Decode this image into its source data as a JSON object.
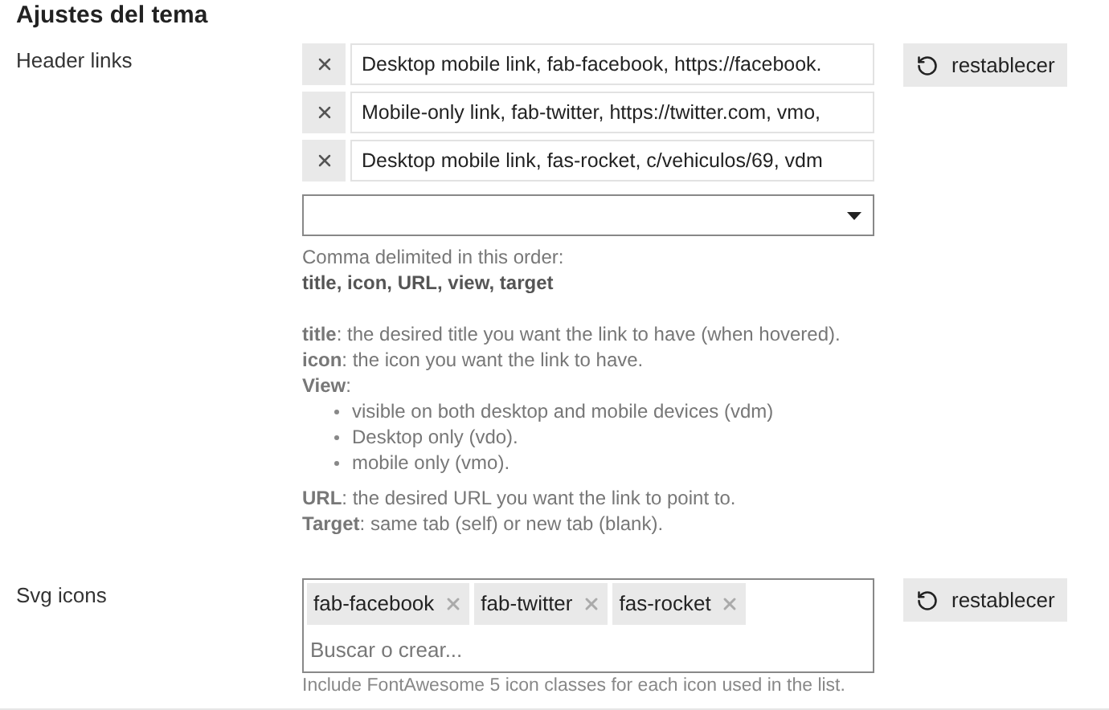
{
  "section_title": "Ajustes del tema",
  "settings": [
    {
      "kind": "list",
      "label": "Header links",
      "items": [
        "Desktop mobile link, fab-facebook, https://facebook.",
        "Mobile-only link, fab-twitter, https://twitter.com, vmo,",
        "Desktop mobile link, fas-rocket, c/vehiculos/69, vdm"
      ],
      "help": {
        "intro": "Comma delimited in this order:",
        "order": "title, icon, URL, view, target",
        "definitions": [
          "**title**: the desired title you want the link to have (when hovered).",
          "**icon**: the icon you want the link to have.",
          "**View**:"
        ],
        "view_options": [
          "visible on both desktop and mobile devices (vdm)",
          "Desktop only (vdo).",
          "mobile only (vmo)."
        ],
        "more": [
          "**URL**: the desired URL you want the link to point to.",
          "**Target**: same tab (self) or new tab (blank)."
        ]
      },
      "reset_button": "restablecer"
    },
    {
      "kind": "tags",
      "label": "Svg icons",
      "tags": [
        "fab-facebook",
        "fab-twitter",
        "fas-rocket"
      ],
      "placeholder": "Buscar o crear...",
      "help_text": "Include FontAwesome 5 icon classes for each icon used in the list.",
      "reset_button": "restablecer"
    }
  ]
}
